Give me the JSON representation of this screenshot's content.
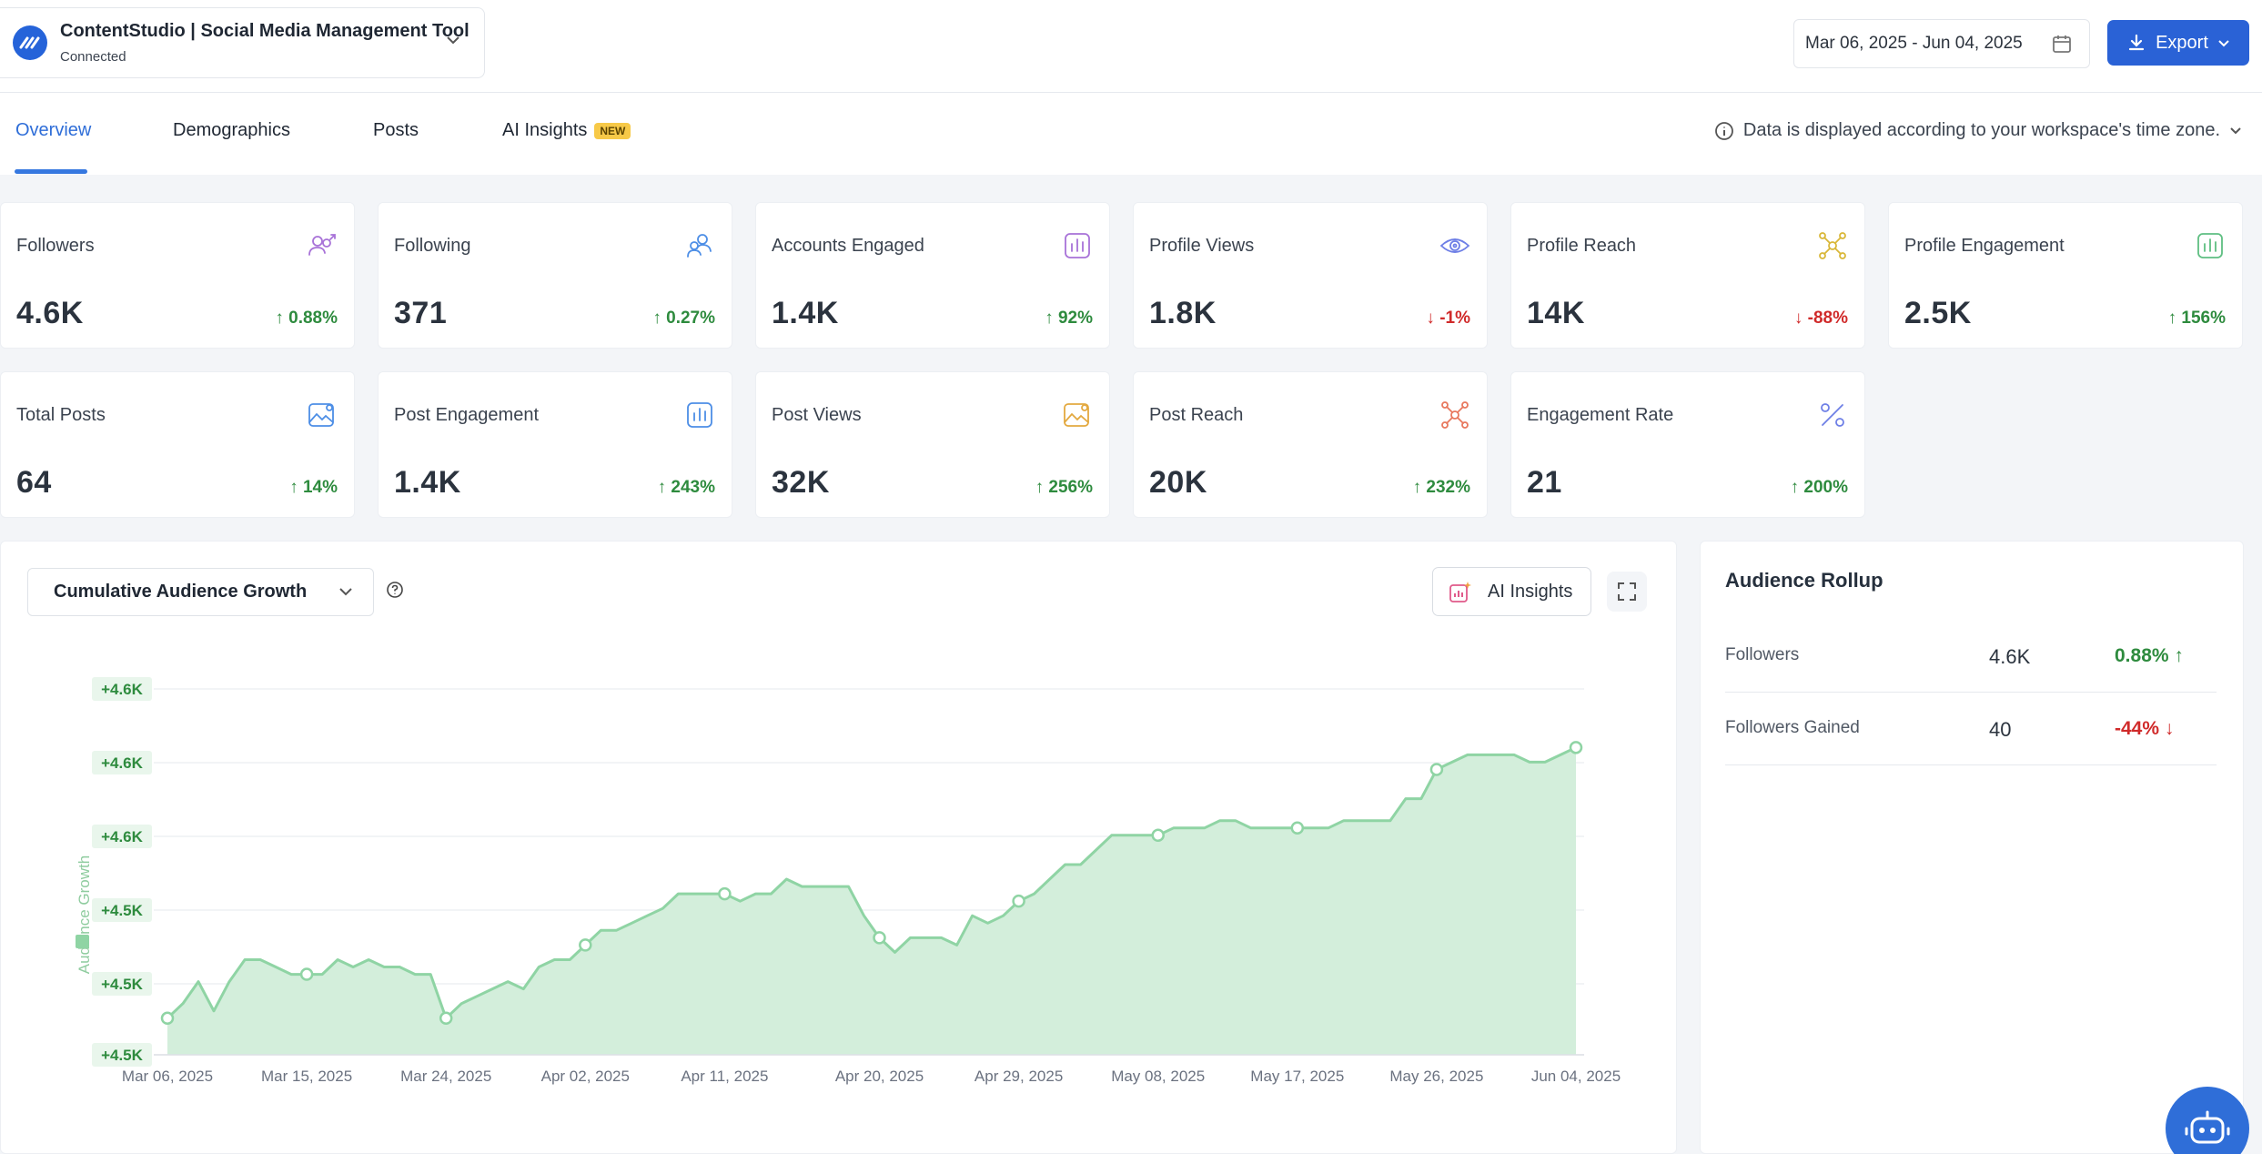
{
  "header": {
    "account_name": "ContentStudio | Social Media Management Tool",
    "account_status": "Connected",
    "date_range": "Mar 06, 2025 - Jun 04, 2025",
    "export_label": "Export"
  },
  "tabs": [
    {
      "label": "Overview",
      "active": true
    },
    {
      "label": "Demographics",
      "active": false
    },
    {
      "label": "Posts",
      "active": false
    },
    {
      "label": "AI Insights",
      "active": false,
      "badge": "NEW"
    }
  ],
  "timezone_note": "Data is displayed according to your workspace's time zone.",
  "metrics": [
    {
      "title": "Followers",
      "value": "4.6K",
      "change": "0.88%",
      "direction": "up",
      "icon": "followers-icon",
      "color": "#a872d8"
    },
    {
      "title": "Following",
      "value": "371",
      "change": "0.27%",
      "direction": "up",
      "icon": "following-icon",
      "color": "#4d8ee6"
    },
    {
      "title": "Accounts Engaged",
      "value": "1.4K",
      "change": "92%",
      "direction": "up",
      "icon": "bar-chart-icon",
      "color": "#a872d8"
    },
    {
      "title": "Profile Views",
      "value": "1.8K",
      "change": "-1%",
      "direction": "down",
      "icon": "eye-icon",
      "color": "#6e7fe6"
    },
    {
      "title": "Profile Reach",
      "value": "14K",
      "change": "-88%",
      "direction": "down",
      "icon": "reach-icon",
      "color": "#d9b738"
    },
    {
      "title": "Profile Engagement",
      "value": "2.5K",
      "change": "156%",
      "direction": "up",
      "icon": "bar-chart-icon",
      "color": "#5fbf82"
    },
    {
      "title": "Total Posts",
      "value": "64",
      "change": "14%",
      "direction": "up",
      "icon": "image-icon",
      "color": "#4d8ee6"
    },
    {
      "title": "Post Engagement",
      "value": "1.4K",
      "change": "243%",
      "direction": "up",
      "icon": "bar-chart-icon",
      "color": "#4d8ee6"
    },
    {
      "title": "Post Views",
      "value": "32K",
      "change": "256%",
      "direction": "up",
      "icon": "image-icon",
      "color": "#e3a940"
    },
    {
      "title": "Post Reach",
      "value": "20K",
      "change": "232%",
      "direction": "up",
      "icon": "reach-icon",
      "color": "#e8775d"
    },
    {
      "title": "Engagement Rate",
      "value": "21",
      "change": "200%",
      "direction": "up",
      "icon": "percent-icon",
      "color": "#6e7fe6"
    }
  ],
  "chart_panel": {
    "selector_label": "Cumulative Audience Growth",
    "ai_insights_label": "AI Insights"
  },
  "chart_data": {
    "type": "area",
    "ylabel": "Audience Growth",
    "y_tick_labels": [
      "+4.6K",
      "+4.6K",
      "+4.6K",
      "+4.5K",
      "+4.5K",
      "+4.5K"
    ],
    "x_tick_labels": [
      "Mar 06, 2025",
      "Mar 15, 2025",
      "Mar 24, 2025",
      "Apr 02, 2025",
      "Apr 11, 2025",
      "Apr 20, 2025",
      "Apr 29, 2025",
      "May 08, 2025",
      "May 17, 2025",
      "May 26, 2025",
      "Jun 04, 2025"
    ],
    "ylim": [
      4540,
      4590
    ],
    "color": "#8fd4a4",
    "grid": true,
    "series": [
      {
        "values": [
          4545,
          4547,
          4550,
          4546,
          4550,
          4553,
          4553,
          4552,
          4551,
          4551,
          4551,
          4553,
          4552,
          4553,
          4552,
          4552,
          4551,
          4551,
          4545,
          4547,
          4548,
          4549,
          4550,
          4549,
          4552,
          4553,
          4553,
          4555,
          4557,
          4557,
          4558,
          4559,
          4560,
          4562,
          4562,
          4562,
          4562,
          4561,
          4562,
          4562,
          4564,
          4563,
          4563,
          4563,
          4563,
          4559,
          4556,
          4554,
          4556,
          4556,
          4556,
          4555,
          4559,
          4558,
          4559,
          4561,
          4562,
          4564,
          4566,
          4566,
          4568,
          4570,
          4570,
          4570,
          4570,
          4571,
          4571,
          4571,
          4572,
          4572,
          4571,
          4571,
          4571,
          4571,
          4571,
          4571,
          4572,
          4572,
          4572,
          4572,
          4575,
          4575,
          4579,
          4580,
          4581,
          4581,
          4581,
          4581,
          4580,
          4580,
          4581,
          4582
        ]
      }
    ]
  },
  "rollup": {
    "title": "Audience Rollup",
    "rows": [
      {
        "label": "Followers",
        "value": "4.6K",
        "change": "0.88%",
        "direction": "up"
      },
      {
        "label": "Followers Gained",
        "value": "40",
        "change": "-44%",
        "direction": "down"
      }
    ]
  }
}
